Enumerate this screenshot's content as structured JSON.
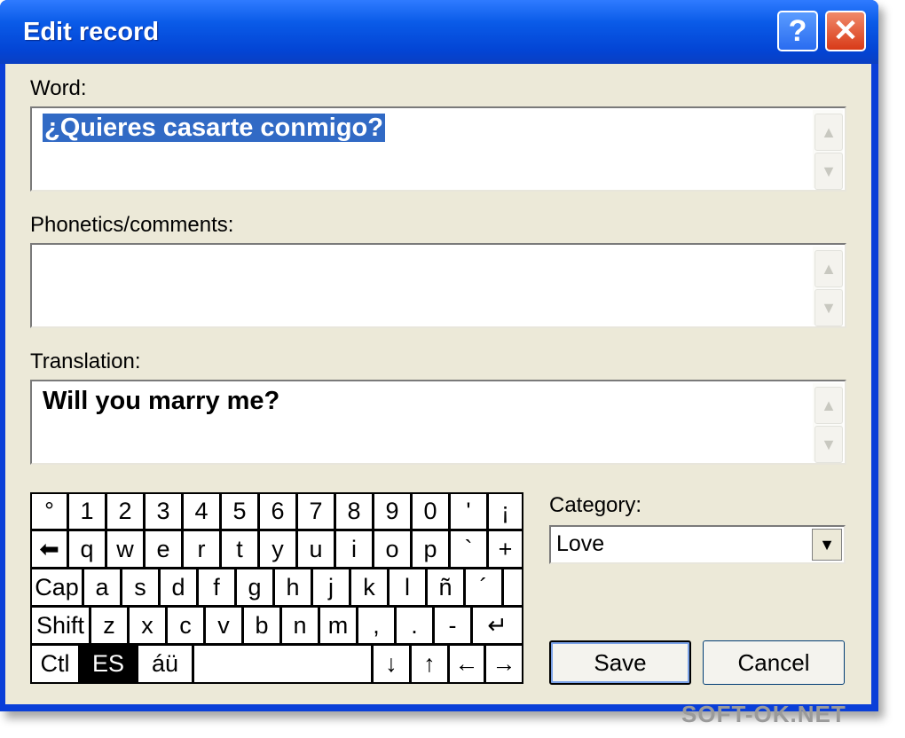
{
  "window": {
    "title": "Edit record",
    "help_label": "?",
    "close_label": "✕"
  },
  "fields": {
    "word_label": "Word:",
    "word_value": "¿Quieres casarte conmigo?",
    "phonetics_label": "Phonetics/comments:",
    "phonetics_value": "",
    "translation_label": "Translation:",
    "translation_value": "Will you marry me?"
  },
  "scroll": {
    "up": "▲",
    "down": "▼"
  },
  "keyboard": {
    "rows": [
      [
        "°",
        "1",
        "2",
        "3",
        "4",
        "5",
        "6",
        "7",
        "8",
        "9",
        "0",
        "'",
        "¡"
      ],
      [
        "⬅",
        "q",
        "w",
        "e",
        "r",
        "t",
        "y",
        "u",
        "i",
        "o",
        "p",
        "`",
        "+"
      ],
      [
        "Cap",
        "a",
        "s",
        "d",
        "f",
        "g",
        "h",
        "j",
        "k",
        "l",
        "ñ",
        "´"
      ],
      [
        "Shift",
        "z",
        "x",
        "c",
        "v",
        "b",
        "n",
        "m",
        ",",
        ".",
        "-",
        "↵"
      ],
      [
        "Ctl",
        "ES",
        "áü",
        "",
        "↓",
        "↑",
        "←",
        "→"
      ]
    ]
  },
  "category": {
    "label": "Category:",
    "value": "Love",
    "dropdown_icon": "▼"
  },
  "buttons": {
    "save": "Save",
    "cancel": "Cancel"
  },
  "watermark": "SOFT-OK.NET"
}
